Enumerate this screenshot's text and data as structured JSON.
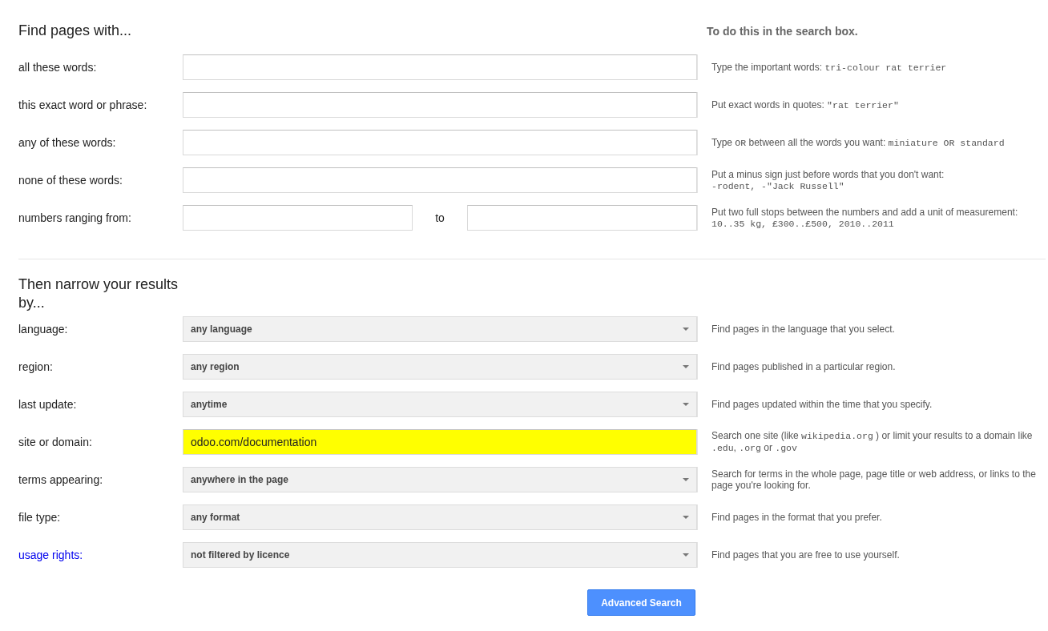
{
  "find_section": {
    "heading": "Find pages with...",
    "hint_heading": "To do this in the search box.",
    "rows": [
      {
        "label": "all these words:",
        "kind": "text",
        "hint": [
          [
            {
              "text": "Type the important words: ",
              "code": false
            },
            {
              "text": "tri-colour rat terrier",
              "code": true
            }
          ]
        ]
      },
      {
        "label": "this exact word or phrase:",
        "kind": "text",
        "hint": [
          [
            {
              "text": "Put exact words in quotes: ",
              "code": false
            },
            {
              "text": "\"rat terrier\"",
              "code": true
            }
          ]
        ]
      },
      {
        "label": "any of these words:",
        "kind": "text",
        "hint": [
          [
            {
              "text": "Type ",
              "code": false
            },
            {
              "text": "OR",
              "code": true
            },
            {
              "text": " between all the words you want: ",
              "code": false
            },
            {
              "text": "miniature OR standard",
              "code": true
            }
          ]
        ]
      },
      {
        "label": "none of these words:",
        "kind": "text",
        "hint": [
          [
            {
              "text": "Put a minus sign just before words that you don't want:",
              "code": false
            }
          ],
          [
            {
              "text": "-rodent, -\"Jack Russell\"",
              "code": true
            }
          ]
        ]
      },
      {
        "label": "numbers ranging from:",
        "kind": "range",
        "separator": "to",
        "hint": [
          [
            {
              "text": "Put two full stops between the numbers and add a unit of measurement:",
              "code": false
            }
          ],
          [
            {
              "text": "10..35 kg, £300..£500, 2010..2011",
              "code": true
            }
          ]
        ]
      }
    ]
  },
  "narrow_section": {
    "heading": "Then narrow your results by...",
    "rows": [
      {
        "label": "language:",
        "link": false,
        "kind": "select",
        "value": "any language",
        "hint": [
          [
            {
              "text": "Find pages in the language that you select.",
              "code": false
            }
          ]
        ]
      },
      {
        "label": "region:",
        "link": false,
        "kind": "select",
        "value": "any region",
        "hint": [
          [
            {
              "text": "Find pages published in a particular region.",
              "code": false
            }
          ]
        ]
      },
      {
        "label": "last update:",
        "link": false,
        "kind": "select",
        "value": "anytime",
        "hint": [
          [
            {
              "text": "Find pages updated within the time that you specify.",
              "code": false
            }
          ]
        ]
      },
      {
        "label": "site or domain:",
        "link": false,
        "kind": "text",
        "value": "odoo.com/documentation",
        "highlighted": true,
        "hint": [
          [
            {
              "text": "Search one site (like ",
              "code": false
            },
            {
              "text": "wikipedia.org",
              "code": true
            },
            {
              "text": " ) or limit your results to a domain like ",
              "code": false
            },
            {
              "text": ".edu",
              "code": true
            },
            {
              "text": ", ",
              "code": false
            },
            {
              "text": ".org",
              "code": true
            },
            {
              "text": " or ",
              "code": false
            },
            {
              "text": ".gov",
              "code": true
            }
          ]
        ]
      },
      {
        "label": "terms appearing:",
        "link": false,
        "kind": "select",
        "value": "anywhere in the page",
        "hint": [
          [
            {
              "text": "Search for terms in the whole page, page title or web address, or links to the page you're looking for.",
              "code": false
            }
          ]
        ]
      },
      {
        "label": "file type:",
        "link": false,
        "kind": "select",
        "value": "any format",
        "hint": [
          [
            {
              "text": "Find pages in the format that you prefer.",
              "code": false
            }
          ]
        ]
      },
      {
        "label": "usage rights:",
        "link": true,
        "kind": "select",
        "value": "not filtered by licence",
        "hint": [
          [
            {
              "text": "Find pages that you are free to use yourself.",
              "code": false
            }
          ]
        ]
      }
    ]
  },
  "submit_button": "Advanced Search"
}
